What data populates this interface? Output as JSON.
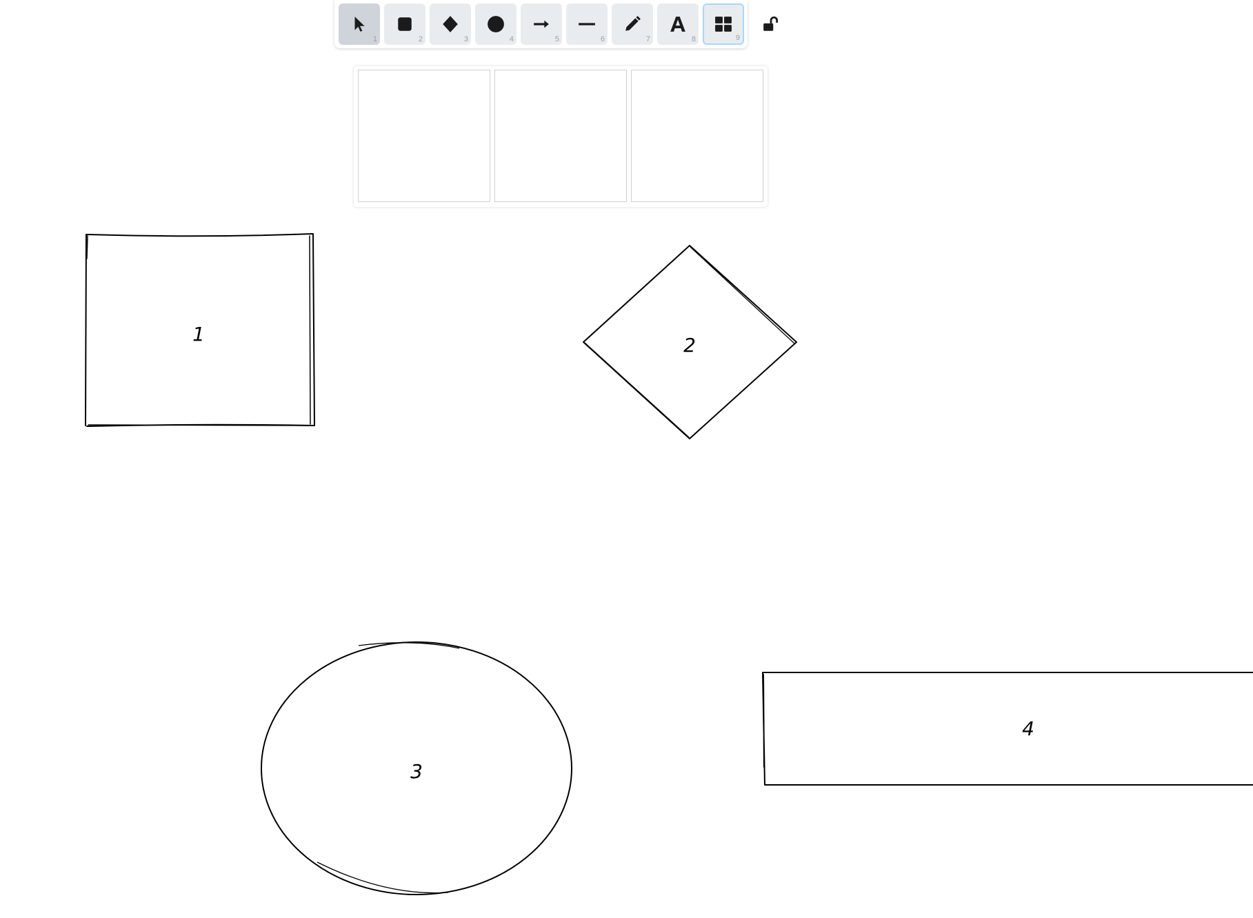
{
  "toolbar": {
    "tools": [
      {
        "name": "select",
        "shortcut": "1",
        "icon": "pointer-icon",
        "state": "active"
      },
      {
        "name": "rectangle",
        "shortcut": "2",
        "icon": "square-icon"
      },
      {
        "name": "diamond",
        "shortcut": "3",
        "icon": "diamond-icon"
      },
      {
        "name": "ellipse",
        "shortcut": "4",
        "icon": "circle-icon"
      },
      {
        "name": "arrow",
        "shortcut": "5",
        "icon": "arrow-right-icon"
      },
      {
        "name": "line",
        "shortcut": "6",
        "icon": "line-icon"
      },
      {
        "name": "draw",
        "shortcut": "7",
        "icon": "pencil-icon"
      },
      {
        "name": "text",
        "shortcut": "8",
        "icon": "text-icon"
      },
      {
        "name": "library",
        "shortcut": "9",
        "icon": "grid-icon",
        "state": "selected"
      }
    ],
    "lock_icon": "unlock-icon"
  },
  "library": {
    "slots": 3
  },
  "canvas": {
    "shapes": [
      {
        "type": "rectangle",
        "label": "1"
      },
      {
        "type": "diamond",
        "label": "2"
      },
      {
        "type": "ellipse",
        "label": "3"
      },
      {
        "type": "rectangle",
        "label": "4"
      }
    ]
  },
  "colors": {
    "stroke": "#000000",
    "tool_bg": "#e9ecef",
    "tool_active_bg": "#ced4da",
    "tool_selected_border": "#a5d8ff",
    "canvas_bg": "#ffffff"
  }
}
